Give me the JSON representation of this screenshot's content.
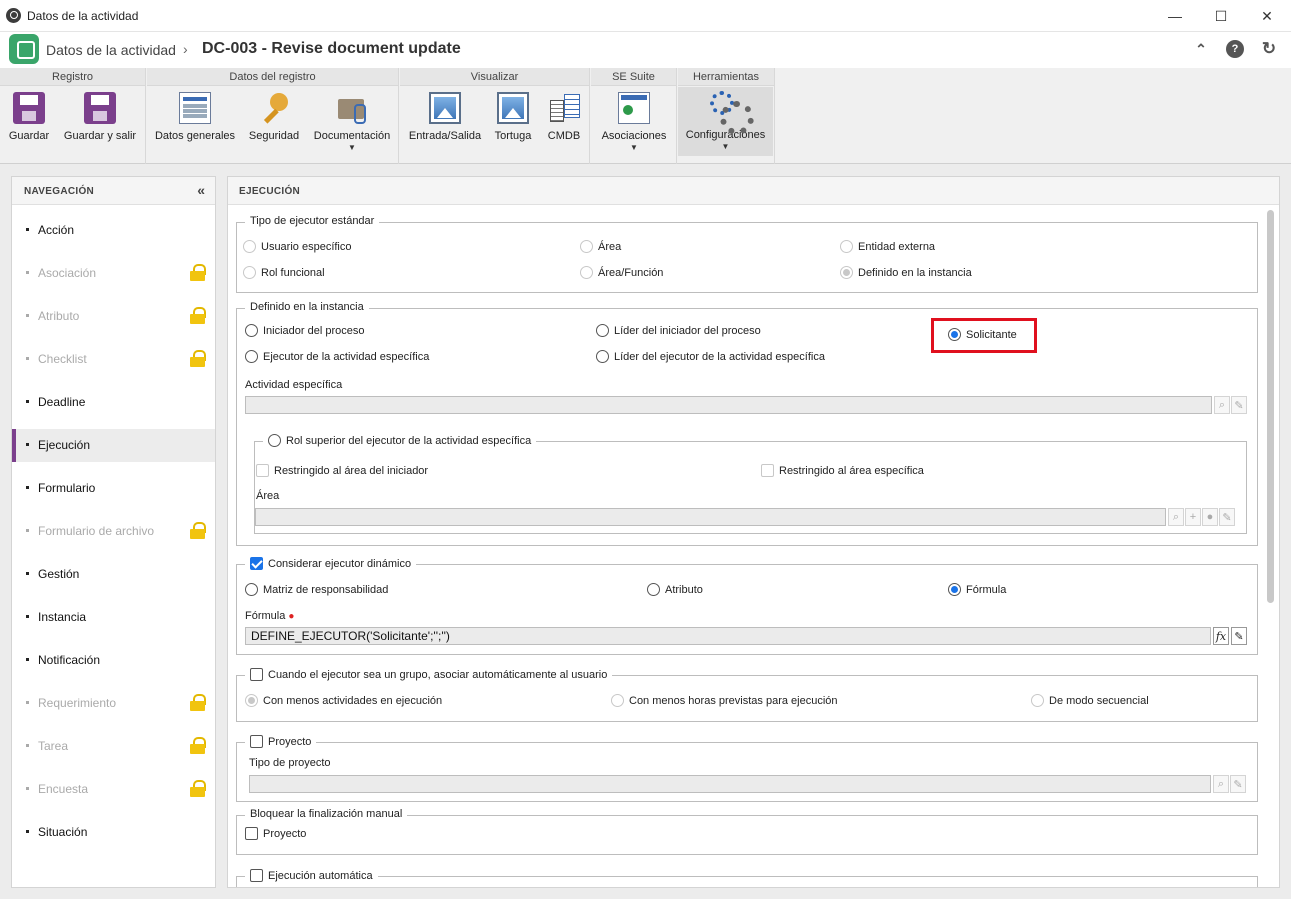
{
  "window": {
    "title": "Datos de la actividad",
    "minimize": "—",
    "maximize": "☐",
    "close": "✕"
  },
  "header": {
    "breadcrumb_parent": "Datos de la actividad",
    "separator": "›",
    "title": "DC-003 - Revise document update",
    "collapse_icon": "⌃",
    "help_icon": "?",
    "refresh_icon": "↻"
  },
  "ribbon": {
    "groups": {
      "registro": "Registro",
      "datos_registro": "Datos del registro",
      "visualizar": "Visualizar",
      "se_suite": "SE Suite",
      "herramientas": "Herramientas"
    },
    "buttons": {
      "guardar": "Guardar",
      "guardar_salir": "Guardar y salir",
      "datos_generales": "Datos generales",
      "seguridad": "Seguridad",
      "documentacion": "Documentación",
      "entrada_salida": "Entrada/Salida",
      "tortuga": "Tortuga",
      "cmdb": "CMDB",
      "asociaciones": "Asociaciones",
      "configuraciones": "Configuraciones"
    },
    "caret": "▼"
  },
  "nav": {
    "title": "NAVEGACIÓN",
    "collapse": "«",
    "items": [
      {
        "label": "Acción"
      },
      {
        "label": "Asociación"
      },
      {
        "label": "Atributo"
      },
      {
        "label": "Checklist"
      },
      {
        "label": "Deadline"
      },
      {
        "label": "Ejecución"
      },
      {
        "label": "Formulario"
      },
      {
        "label": "Formulario de archivo"
      },
      {
        "label": "Gestión"
      },
      {
        "label": "Instancia"
      },
      {
        "label": "Notificación"
      },
      {
        "label": "Requerimiento"
      },
      {
        "label": "Tarea"
      },
      {
        "label": "Encuesta"
      },
      {
        "label": "Situación"
      }
    ]
  },
  "panel": {
    "title": "EJECUCIÓN",
    "tipo": {
      "legend": "Tipo de ejecutor estándar",
      "usuario": "Usuario específico",
      "area": "Área",
      "entidad": "Entidad externa",
      "rol": "Rol funcional",
      "area_funcion": "Área/Función",
      "definido": "Definido en la instancia"
    },
    "definido": {
      "legend": "Definido en la instancia",
      "iniciador": "Iniciador del proceso",
      "lider_iniciador": "Líder del iniciador del proceso",
      "solicitante": "Solicitante",
      "ejecutor": "Ejecutor de la actividad específica",
      "lider_ejecutor": "Líder del ejecutor de la actividad específica",
      "actividad_label": "Actividad específica",
      "actividad_value": "",
      "rol_superior": "Rol superior del ejecutor de la actividad específica",
      "restringido_iniciador": "Restringido al área del iniciador",
      "restringido_especifica": "Restringido al área específica",
      "area_label": "Área",
      "area_value": ""
    },
    "dinamico": {
      "legend": "Considerar ejecutor dinámico",
      "matriz": "Matriz de responsabilidad",
      "atributo": "Atributo",
      "formula": "Fórmula",
      "formula_label": "Fórmula",
      "formula_value": "DEFINE_EJECUTOR('Solicitante';'';'')",
      "fx": "fx"
    },
    "grupo": {
      "legend": "Cuando el ejecutor sea un grupo, asociar automáticamente al usuario",
      "menos_actividades": "Con menos actividades en ejecución",
      "menos_horas": "Con menos horas previstas para ejecución",
      "secuencial": "De modo secuencial"
    },
    "proyecto": {
      "legend": "Proyecto",
      "tipo_label": "Tipo de proyecto",
      "tipo_value": ""
    },
    "bloquear": {
      "legend": "Bloquear la finalización manual",
      "proyecto": "Proyecto"
    },
    "automatica": {
      "legend": "Ejecución automática"
    }
  }
}
